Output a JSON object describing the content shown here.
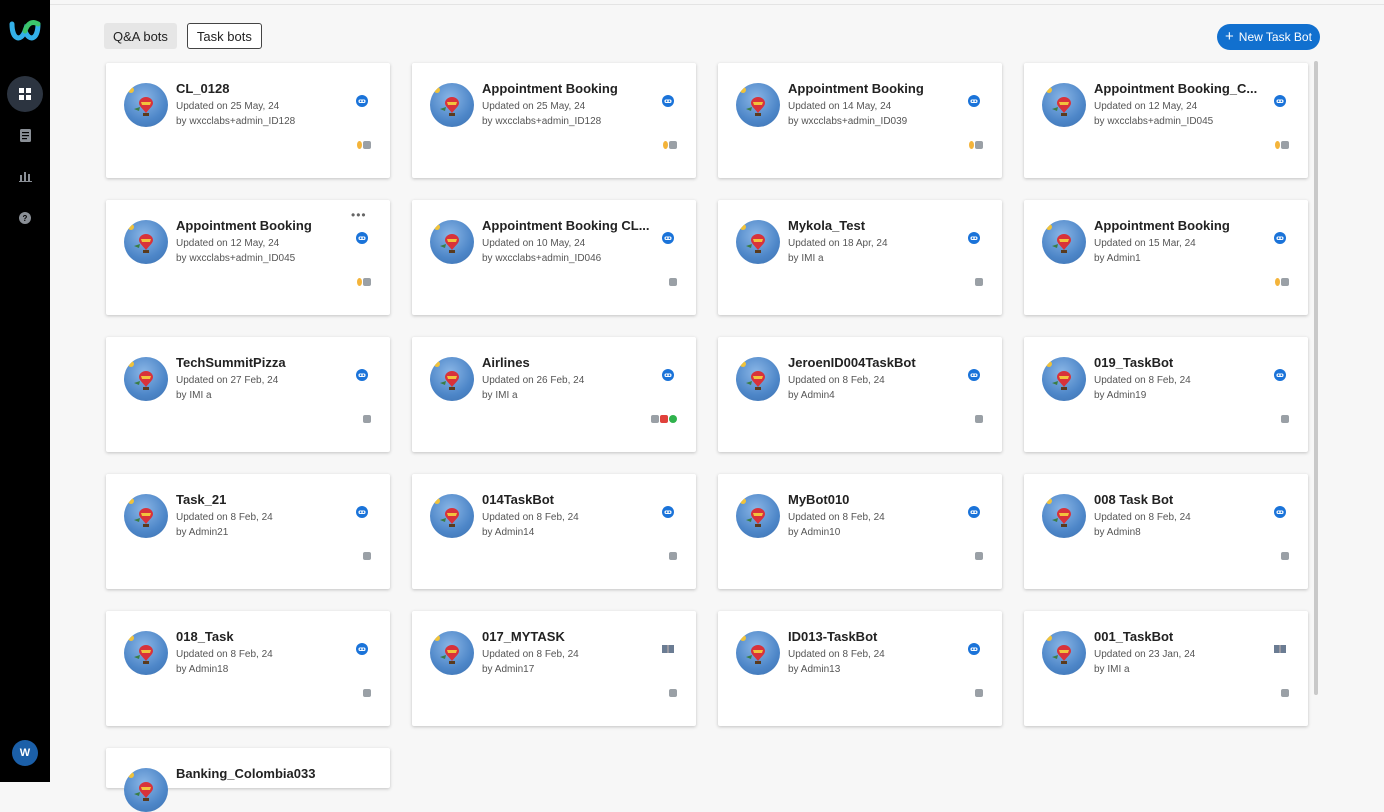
{
  "tabs": {
    "qa": "Q&A bots",
    "task": "Task bots"
  },
  "new_button": {
    "label": "New Task Bot"
  },
  "user_avatar": "W",
  "colors": {
    "accent": "#1170cf",
    "rail": "#000000"
  },
  "nav_icons": [
    "dashboard-icon",
    "document-icon",
    "analytics-icon",
    "help-icon"
  ],
  "cards": [
    {
      "title": "CL_0128",
      "updated": "Updated on 25 May, 24",
      "by": "by wxcclabs+admin_ID128",
      "type_icon": "bot-icon",
      "channels": [
        "voice",
        "chat"
      ]
    },
    {
      "title": "Appointment Booking",
      "updated": "Updated on 25 May, 24",
      "by": "by wxcclabs+admin_ID128",
      "type_icon": "bot-icon",
      "channels": [
        "voice",
        "chat"
      ]
    },
    {
      "title": "Appointment Booking",
      "updated": "Updated on 14 May, 24",
      "by": "by wxcclabs+admin_ID039",
      "type_icon": "bot-icon",
      "channels": [
        "voice",
        "chat"
      ]
    },
    {
      "title": "Appointment Booking_C...",
      "updated": "Updated on 12 May, 24",
      "by": "by wxcclabs+admin_ID045",
      "type_icon": "bot-icon",
      "channels": [
        "voice",
        "chat"
      ]
    },
    {
      "title": "Appointment Booking",
      "updated": "Updated on 12 May, 24",
      "by": "by wxcclabs+admin_ID045",
      "type_icon": "bot-icon",
      "channels": [
        "voice",
        "chat"
      ],
      "menu": "•••"
    },
    {
      "title": "Appointment Booking CL...",
      "updated": "Updated on 10 May, 24",
      "by": "by wxcclabs+admin_ID046",
      "type_icon": "bot-icon",
      "channels": [
        "chat"
      ]
    },
    {
      "title": "Mykola_Test",
      "updated": "Updated on 18 Apr, 24",
      "by": "by IMI a",
      "type_icon": "bot-icon",
      "channels": [
        "chat"
      ]
    },
    {
      "title": "Appointment Booking",
      "updated": "Updated on 15 Mar, 24",
      "by": "by Admin1",
      "type_icon": "bot-icon",
      "channels": [
        "voice",
        "chat"
      ]
    },
    {
      "title": "TechSummitPizza",
      "updated": "Updated on 27 Feb, 24",
      "by": "by IMI a",
      "type_icon": "bot-icon",
      "channels": [
        "chat"
      ]
    },
    {
      "title": "Airlines",
      "updated": "Updated on 26 Feb, 24",
      "by": "by IMI a",
      "type_icon": "bot-icon",
      "channels": [
        "chat",
        "sms",
        "wa"
      ]
    },
    {
      "title": "JeroenID004TaskBot",
      "updated": "Updated on 8 Feb, 24",
      "by": "by Admin4",
      "type_icon": "bot-icon",
      "channels": [
        "chat"
      ]
    },
    {
      "title": "019_TaskBot",
      "updated": "Updated on 8 Feb, 24",
      "by": "by Admin19",
      "type_icon": "bot-icon",
      "channels": [
        "chat"
      ]
    },
    {
      "title": "Task_21",
      "updated": "Updated on 8 Feb, 24",
      "by": "by Admin21",
      "type_icon": "bot-icon",
      "channels": [
        "chat"
      ]
    },
    {
      "title": "014TaskBot",
      "updated": "Updated on 8 Feb, 24",
      "by": "by Admin14",
      "type_icon": "bot-icon",
      "channels": [
        "chat"
      ]
    },
    {
      "title": "MyBot010",
      "updated": "Updated on 8 Feb, 24",
      "by": "by Admin10",
      "type_icon": "bot-icon",
      "channels": [
        "chat"
      ]
    },
    {
      "title": "008 Task Bot",
      "updated": "Updated on 8 Feb, 24",
      "by": "by Admin8",
      "type_icon": "bot-icon",
      "channels": [
        "chat"
      ]
    },
    {
      "title": "018_Task",
      "updated": "Updated on 8 Feb, 24",
      "by": "by Admin18",
      "type_icon": "bot-icon",
      "channels": [
        "chat"
      ]
    },
    {
      "title": "017_MYTASK",
      "updated": "Updated on 8 Feb, 24",
      "by": "by Admin17",
      "type_icon": "book-icon",
      "channels": [
        "chat"
      ]
    },
    {
      "title": "ID013-TaskBot",
      "updated": "Updated on 8 Feb, 24",
      "by": "by Admin13",
      "type_icon": "bot-icon",
      "channels": [
        "chat"
      ]
    },
    {
      "title": "001_TaskBot",
      "updated": "Updated on 23 Jan, 24",
      "by": "by IMI a",
      "type_icon": "book-icon",
      "channels": [
        "chat"
      ]
    },
    {
      "title": "Banking_Colombia033",
      "updated": "",
      "by": "",
      "type_icon": "bot-icon",
      "channels": []
    }
  ]
}
